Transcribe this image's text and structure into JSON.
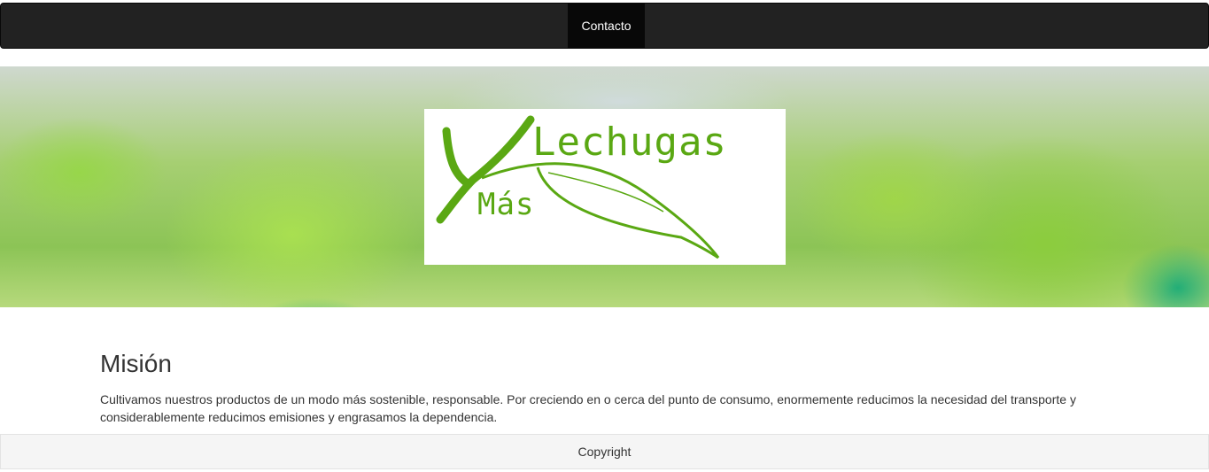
{
  "navbar": {
    "items": [
      {
        "label": "Contacto",
        "active": true
      }
    ],
    "background": "#222222"
  },
  "hero": {
    "logo": {
      "word1": "Lechugas",
      "word2": "Más",
      "brand_color": "#5aa813"
    }
  },
  "mission": {
    "title": "Misión",
    "text": "Cultivamos nuestros productos de un modo más sostenible, responsable. Por creciendo en o cerca del punto de consumo, enormemente reducimos la necesidad del transporte y considerablemente reducimos emisiones y engrasamos la dependencia."
  },
  "footer": {
    "copyright": "Copyright"
  }
}
